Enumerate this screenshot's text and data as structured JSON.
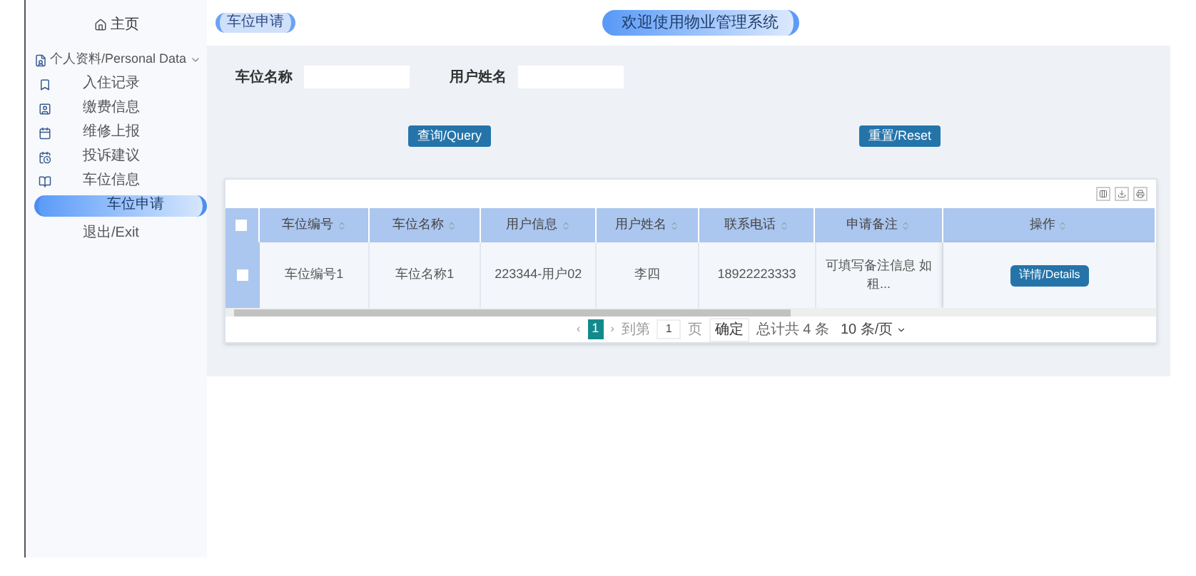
{
  "sidebar": {
    "home": "主页",
    "items": [
      {
        "kind": "group",
        "label": "个人资料/Personal Data",
        "expanded": true,
        "children": [
          {
            "label": "入住记录",
            "selected": false
          },
          {
            "label": "缴费信息",
            "selected": false
          },
          {
            "label": "维修上报",
            "selected": false
          },
          {
            "label": "投诉建议",
            "selected": false
          },
          {
            "label": "车位信息",
            "selected": false
          },
          {
            "label": "车位申请",
            "selected": true
          }
        ]
      },
      {
        "kind": "link",
        "label": "退出/Exit",
        "selected": false
      }
    ]
  },
  "breadcrumb": "车位申请",
  "title": "欢迎使用物业管理系统",
  "search": {
    "fields": [
      {
        "label": "车位名称"
      },
      {
        "label": "用户姓名"
      }
    ],
    "buttons": [
      "查询/Query",
      "重置/Reset"
    ]
  },
  "table": {
    "header_checked": false,
    "columns": [
      "车位编号",
      "车位名称",
      "用户信息",
      "用户姓名",
      "联系电话",
      "申请备注",
      "操作"
    ],
    "rows": [
      {
        "checked": false,
        "cells": [
          "车位编号1",
          "车位名称1",
          "223344-用户02",
          "李四",
          "18922223333",
          "可填写备注信息 如租..."
        ],
        "action": "详情/Details"
      }
    ]
  },
  "pagination": {
    "prev": "‹",
    "pages": [
      {
        "label": "1",
        "selected": true
      }
    ],
    "next": "›",
    "goto": "到第",
    "page_input": "1",
    "page_unit": "页",
    "confirm": "确定",
    "total": "总计共 4 条",
    "page_size": "10 条/页"
  }
}
